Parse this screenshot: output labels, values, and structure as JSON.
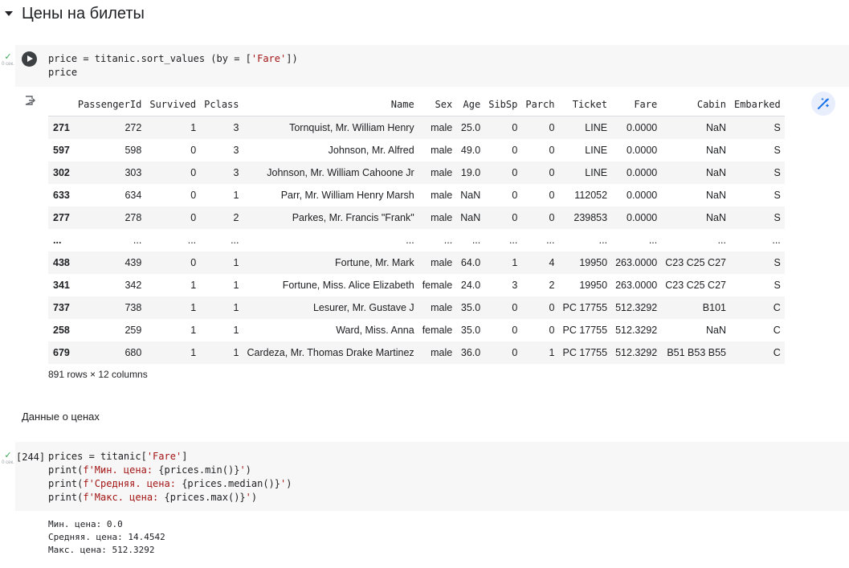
{
  "section": {
    "title": "Цены на билеты"
  },
  "cell1": {
    "status_text": "0 сек.",
    "code_lines": [
      {
        "parts": [
          {
            "t": "price = titanic.sort_values (by = ["
          },
          {
            "t": "'Fare'",
            "s": true
          },
          {
            "t": "])"
          }
        ]
      },
      {
        "parts": [
          {
            "t": "price"
          }
        ]
      }
    ]
  },
  "dataframe": {
    "columns": [
      "",
      "PassengerId",
      "Survived",
      "Pclass",
      "Name",
      "Sex",
      "Age",
      "SibSp",
      "Parch",
      "Ticket",
      "Fare",
      "Cabin",
      "Embarked"
    ],
    "rows": [
      [
        "271",
        "272",
        "1",
        "3",
        "Tornquist, Mr. William Henry",
        "male",
        "25.0",
        "0",
        "0",
        "LINE",
        "0.0000",
        "NaN",
        "S"
      ],
      [
        "597",
        "598",
        "0",
        "3",
        "Johnson, Mr. Alfred",
        "male",
        "49.0",
        "0",
        "0",
        "LINE",
        "0.0000",
        "NaN",
        "S"
      ],
      [
        "302",
        "303",
        "0",
        "3",
        "Johnson, Mr. William Cahoone Jr",
        "male",
        "19.0",
        "0",
        "0",
        "LINE",
        "0.0000",
        "NaN",
        "S"
      ],
      [
        "633",
        "634",
        "0",
        "1",
        "Parr, Mr. William Henry Marsh",
        "male",
        "NaN",
        "0",
        "0",
        "112052",
        "0.0000",
        "NaN",
        "S"
      ],
      [
        "277",
        "278",
        "0",
        "2",
        "Parkes, Mr. Francis \"Frank\"",
        "male",
        "NaN",
        "0",
        "0",
        "239853",
        "0.0000",
        "NaN",
        "S"
      ],
      [
        "...",
        "...",
        "...",
        "...",
        "...",
        "...",
        "...",
        "...",
        "...",
        "...",
        "...",
        "...",
        "..."
      ],
      [
        "438",
        "439",
        "0",
        "1",
        "Fortune, Mr. Mark",
        "male",
        "64.0",
        "1",
        "4",
        "19950",
        "263.0000",
        "C23 C25 C27",
        "S"
      ],
      [
        "341",
        "342",
        "1",
        "1",
        "Fortune, Miss. Alice Elizabeth",
        "female",
        "24.0",
        "3",
        "2",
        "19950",
        "263.0000",
        "C23 C25 C27",
        "S"
      ],
      [
        "737",
        "738",
        "1",
        "1",
        "Lesurer, Mr. Gustave J",
        "male",
        "35.0",
        "0",
        "0",
        "PC 17755",
        "512.3292",
        "B101",
        "C"
      ],
      [
        "258",
        "259",
        "1",
        "1",
        "Ward, Miss. Anna",
        "female",
        "35.0",
        "0",
        "0",
        "PC 17755",
        "512.3292",
        "NaN",
        "C"
      ],
      [
        "679",
        "680",
        "1",
        "1",
        "Cardeza, Mr. Thomas Drake Martinez",
        "male",
        "36.0",
        "0",
        "1",
        "PC 17755",
        "512.3292",
        "B51 B53 B55",
        "C"
      ]
    ],
    "footer": "891 rows × 12 columns"
  },
  "markdown": {
    "text": "Данные о ценах"
  },
  "cell2": {
    "execution_count": "[244]",
    "status_text": "0 сек.",
    "code_lines": [
      {
        "parts": [
          {
            "t": "prices = titanic["
          },
          {
            "t": "'Fare'",
            "s": true
          },
          {
            "t": "]"
          }
        ]
      },
      {
        "parts": [
          {
            "t": "print("
          },
          {
            "t": "f'Мин. цена: ",
            "s": true
          },
          {
            "t": "{prices.min()}"
          },
          {
            "t": "'",
            "s": true
          },
          {
            "t": ")"
          }
        ]
      },
      {
        "parts": [
          {
            "t": "print("
          },
          {
            "t": "f'Средняя. цена: ",
            "s": true
          },
          {
            "t": "{prices.median()}"
          },
          {
            "t": "'",
            "s": true
          },
          {
            "t": ")"
          }
        ]
      },
      {
        "parts": [
          {
            "t": "print("
          },
          {
            "t": "f'Макс. цена: ",
            "s": true
          },
          {
            "t": "{prices.max()}"
          },
          {
            "t": "'",
            "s": true
          },
          {
            "t": ")"
          }
        ]
      }
    ],
    "output_lines": [
      "Мин. цена: 0.0",
      "Средняя. цена: 14.4542",
      "Макс. цена: 512.3292"
    ]
  },
  "colors": {
    "string": "#a31515",
    "check": "#34a853",
    "cell_bg": "#f7f7f7",
    "accent": "#1a73e8"
  },
  "icons": {
    "run": "play-icon",
    "output": "output-icon",
    "magic": "magic-wand-icon",
    "status": "check-icon",
    "toggle": "caret-down-icon"
  }
}
